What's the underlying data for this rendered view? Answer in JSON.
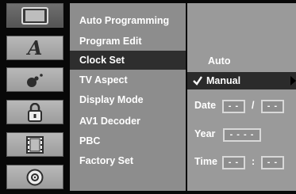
{
  "icons": [
    {
      "name": "display-icon"
    },
    {
      "name": "language-icon",
      "glyph": "A"
    },
    {
      "name": "audio-icon"
    },
    {
      "name": "lock-icon"
    },
    {
      "name": "film-icon"
    },
    {
      "name": "disc-icon"
    }
  ],
  "menu": {
    "items": [
      {
        "label": "Auto Programming"
      },
      {
        "label": "Program Edit"
      },
      {
        "label": "Clock Set"
      },
      {
        "label": "TV Aspect"
      },
      {
        "label": "Display Mode"
      },
      {
        "label": "AV1 Decoder"
      },
      {
        "label": "PBC"
      },
      {
        "label": "Factory Set"
      }
    ],
    "selected": "Clock Set"
  },
  "clock": {
    "options": [
      {
        "label": "Auto"
      },
      {
        "label": "Manual",
        "checked": true
      }
    ],
    "date_label": "Date",
    "date_month": "- -",
    "date_sep": "/",
    "date_day": "- -",
    "year_label": "Year",
    "year_value": "- - - -",
    "time_label": "Time",
    "time_hour": "- -",
    "time_sep": ":",
    "time_min": "- -"
  },
  "colors": {
    "menu_bg": "#8d8d8d",
    "selected_bg": "#2e2e2e",
    "panel_bg": "#9a9a9a"
  }
}
